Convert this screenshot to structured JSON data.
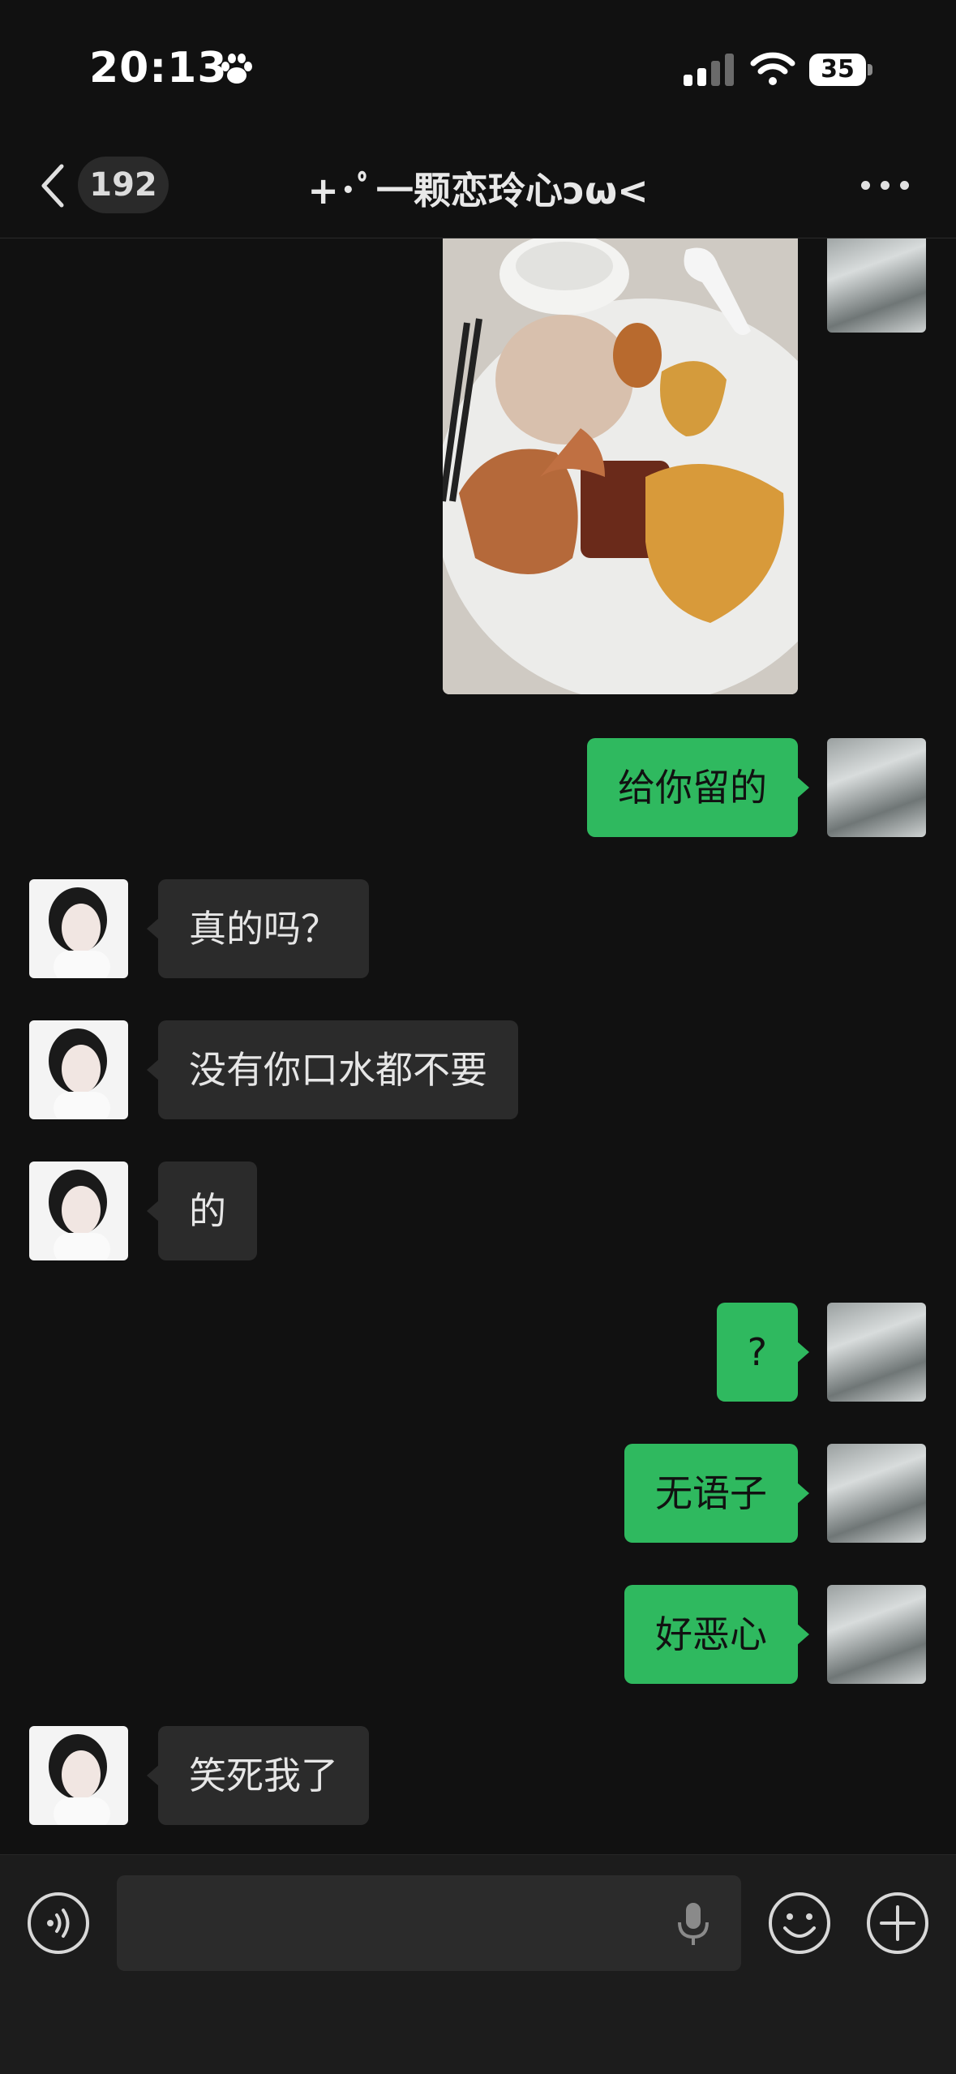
{
  "status_bar": {
    "time": "20:13",
    "battery_level": "35",
    "icons": [
      "paw-icon",
      "signal-icon",
      "wifi-icon",
      "battery-icon"
    ]
  },
  "nav": {
    "back_icon": "chevron-left-icon",
    "unread_count": "192",
    "title": "+･ﾟ一颗恋玲心ↄω<",
    "more_icon": "more-dots-icon"
  },
  "messages": [
    {
      "side": "me",
      "type": "image",
      "description": "food-photo"
    },
    {
      "side": "me",
      "text": "给你留的"
    },
    {
      "side": "other",
      "text": "真的吗？"
    },
    {
      "side": "other",
      "text": "没有你口水都不要"
    },
    {
      "side": "other",
      "text": "的"
    },
    {
      "side": "me",
      "text": "?"
    },
    {
      "side": "me",
      "text": "无语子"
    },
    {
      "side": "me",
      "text": "好恶心"
    },
    {
      "side": "other",
      "text": "笑死我了"
    }
  ],
  "input_bar": {
    "voice_icon": "voice-icon",
    "mic_icon": "mic-icon",
    "emoji_icon": "emoji-icon",
    "plus_icon": "plus-icon",
    "placeholder": ""
  },
  "colors": {
    "background": "#111111",
    "my_bubble": "#2fb95f",
    "other_bubble": "#2b2b2b",
    "input_bar": "#1c1c1c"
  }
}
